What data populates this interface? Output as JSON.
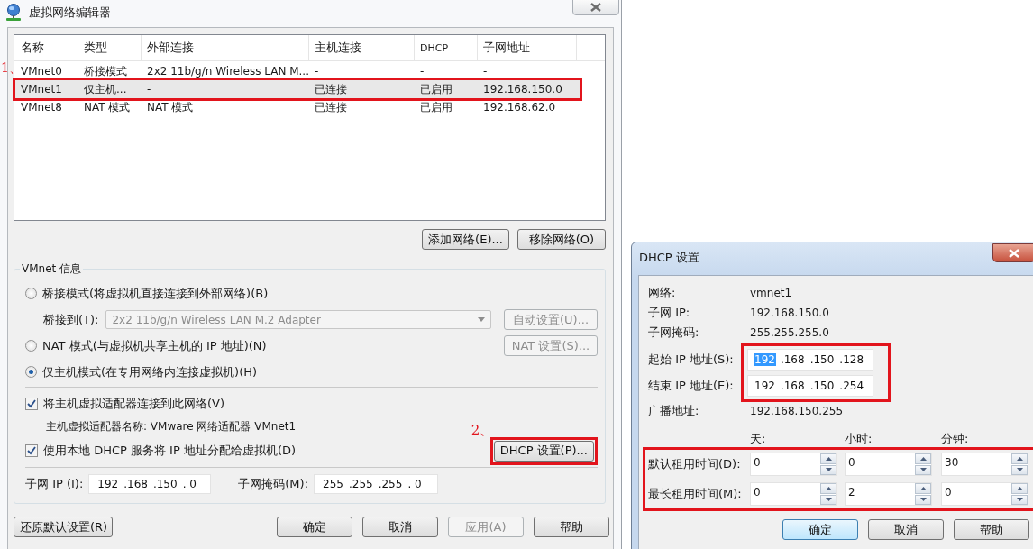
{
  "main_window": {
    "title": "虚拟网络编辑器",
    "network_list": {
      "columns": [
        "名称",
        "类型",
        "外部连接",
        "主机连接",
        "DHCP",
        "子网地址"
      ],
      "rows": [
        {
          "cells": [
            "VMnet0",
            "桥接模式",
            "2x2 11b/g/n Wireless LAN M...",
            "-",
            "-",
            "-"
          ],
          "selected": false,
          "annotated": false
        },
        {
          "cells": [
            "VMnet1",
            "仅主机...",
            "-",
            "已连接",
            "已启用",
            "192.168.150.0"
          ],
          "selected": true,
          "annotated": true
        },
        {
          "cells": [
            "VMnet8",
            "NAT 模式",
            "NAT 模式",
            "已连接",
            "已启用",
            "192.168.62.0"
          ],
          "selected": false,
          "annotated": false
        }
      ]
    },
    "list_buttons": [
      "添加网络(E)...",
      "移除网络(O)"
    ],
    "vmnet_info": {
      "title": "VMnet 信息",
      "bridged_mode": {
        "label": "桥接模式(将虚拟机直接连接到外部网络)(B)",
        "selected": false
      },
      "bridge_to": {
        "label": "桥接到(T):",
        "value": "2x2 11b/g/n Wireless LAN M.2 Adapter",
        "disabled": true
      },
      "auto_button": {
        "label": "自动设置(U)...",
        "disabled": true
      },
      "nat_mode": {
        "label": "NAT 模式(与虚拟机共享主机的 IP 地址)(N)",
        "selected": false
      },
      "nat_button": {
        "label": "NAT 设置(S)...",
        "disabled": true
      },
      "host_only_mode": {
        "label": "仅主机模式(在专用网络内连接虚拟机)(H)",
        "selected": true
      },
      "connect_adapter": {
        "label": "将主机虚拟适配器连接到此网络(V)",
        "checked": true
      },
      "adapter_name": "主机虚拟适配器名称: VMware 网络适配器 VMnet1",
      "use_dhcp": {
        "label": "使用本地 DHCP 服务将 IP 地址分配给虚拟机(D)",
        "checked": true
      },
      "dhcp_button": {
        "label": "DHCP 设置(P)...",
        "annotated": true,
        "annotation": "2、"
      },
      "subnet_ip": {
        "label": "子网 IP (I):",
        "octets": [
          "192",
          ".168",
          ".150",
          ". 0"
        ]
      },
      "subnet_mask": {
        "label": "子网掩码(M):",
        "octets": [
          "255",
          ".255",
          ".255",
          ". 0"
        ]
      }
    },
    "restore_button": "还原默认设置(R)",
    "buttons": [
      {
        "label": "确定",
        "disabled": false
      },
      {
        "label": "取消",
        "disabled": false
      },
      {
        "label": "应用(A)",
        "disabled": true
      },
      {
        "label": "帮助",
        "disabled": false
      }
    ]
  },
  "row_annotation": "1、",
  "dhcp_window": {
    "title": "DHCP 设置",
    "info": [
      {
        "label": "网络:",
        "value": "vmnet1"
      },
      {
        "label": "子网 IP:",
        "value": "192.168.150.0"
      },
      {
        "label": "子网掩码:",
        "value": "255.255.255.0"
      }
    ],
    "range_annotated": true,
    "range": [
      {
        "label": "起始 IP 地址(S):",
        "octets": [
          {
            "text": "192",
            "selected": true
          },
          {
            "text": ".168",
            "selected": false
          },
          {
            "text": ".150",
            "selected": false
          },
          {
            "text": ".128",
            "selected": false
          }
        ]
      },
      {
        "label": "结束 IP 地址(E):",
        "octets": [
          {
            "text": "192",
            "selected": false
          },
          {
            "text": ".168",
            "selected": false
          },
          {
            "text": ".150",
            "selected": false
          },
          {
            "text": ".254",
            "selected": false
          }
        ]
      }
    ],
    "broadcast": {
      "label": "广播地址:",
      "value": "192.168.150.255"
    },
    "lease_columns": [
      "天:",
      "小时:",
      "分钟:"
    ],
    "leases_annotated": true,
    "leases": [
      {
        "label": "默认租用时间(D):",
        "values": [
          "0",
          "0",
          "30"
        ]
      },
      {
        "label": "最长租用时间(M):",
        "values": [
          "0",
          "2",
          "0"
        ]
      }
    ],
    "buttons": [
      {
        "label": "确定",
        "default": true
      },
      {
        "label": "取消",
        "default": false
      },
      {
        "label": "帮助",
        "default": false
      }
    ]
  }
}
